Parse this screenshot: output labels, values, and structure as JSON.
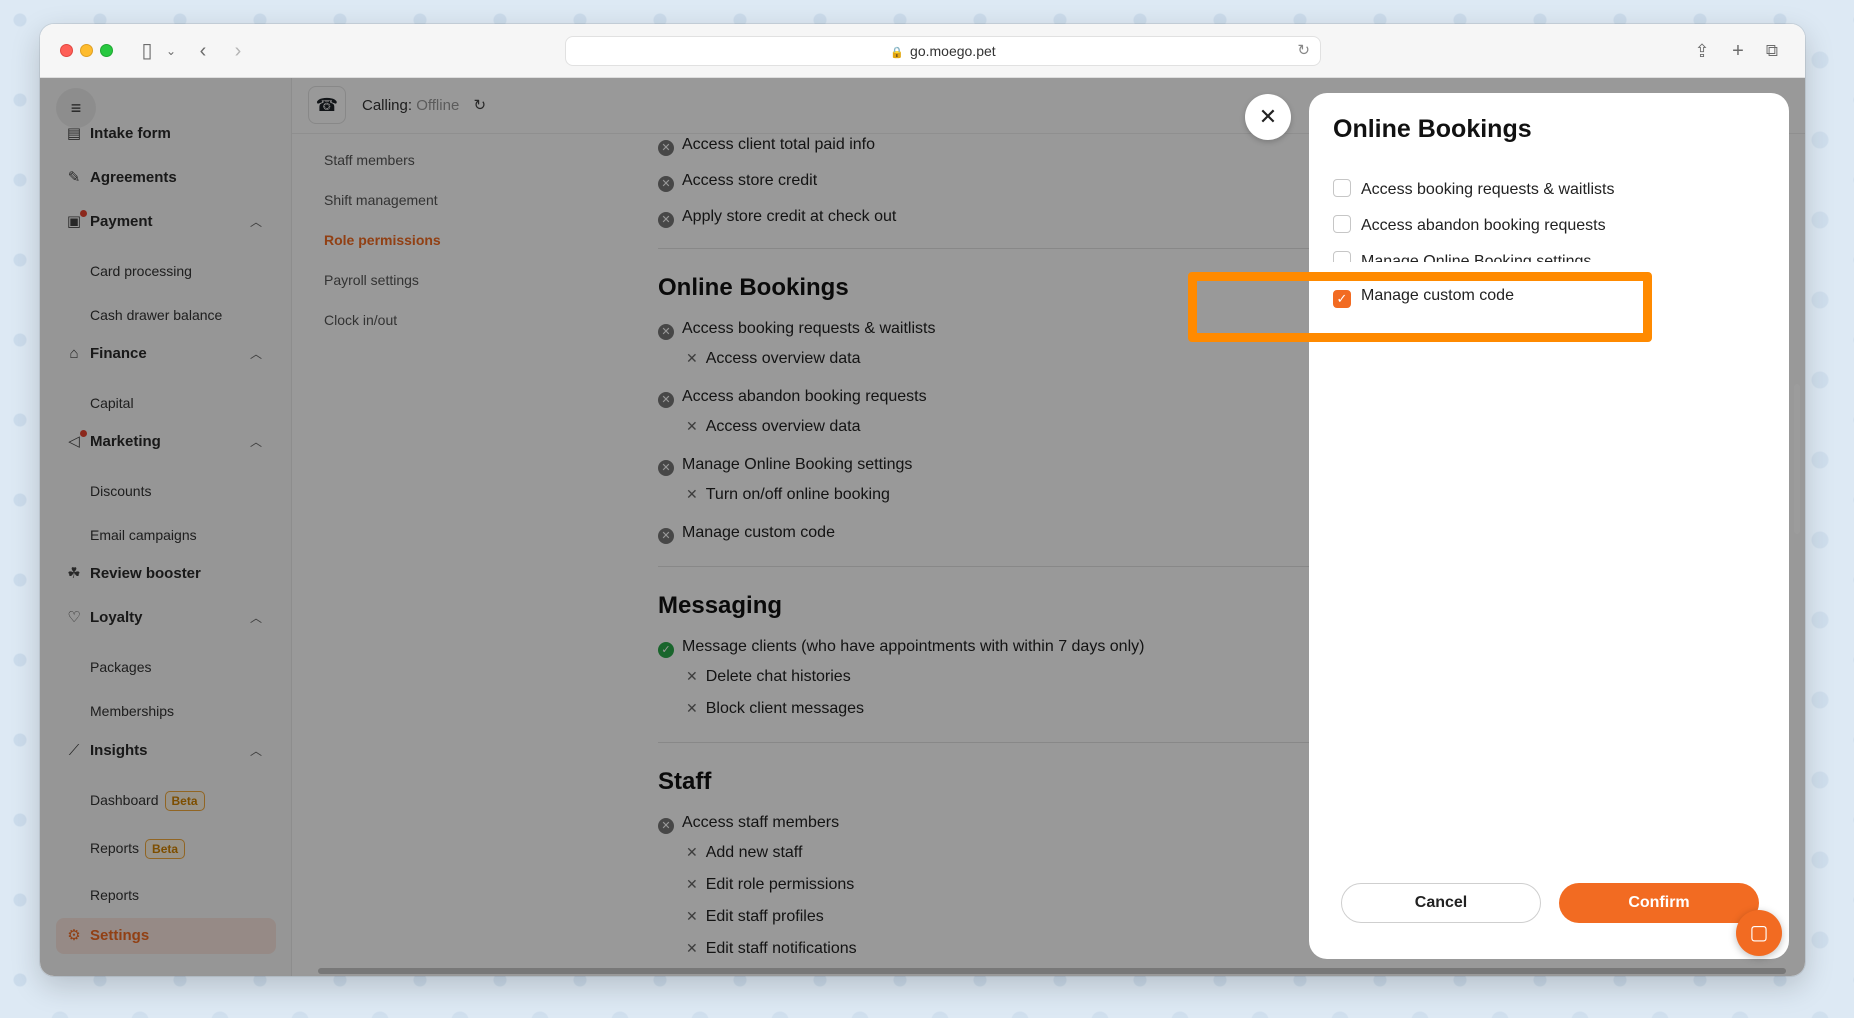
{
  "browser": {
    "url": "go.moego.pet"
  },
  "sidebar": {
    "menu_icon": "hamburger-icon",
    "items": [
      {
        "label": "Intake form",
        "icon": "form-icon"
      },
      {
        "label": "Agreements",
        "icon": "pen-icon"
      },
      {
        "label": "Payment",
        "icon": "payment-icon",
        "expanded": true,
        "dot": true,
        "children": [
          "Card processing",
          "Cash drawer balance"
        ]
      },
      {
        "label": "Finance",
        "icon": "bank-icon",
        "expanded": true,
        "children": [
          "Capital"
        ]
      },
      {
        "label": "Marketing",
        "icon": "megaphone-icon",
        "expanded": true,
        "dot": true,
        "children": [
          "Discounts",
          "Email campaigns"
        ]
      },
      {
        "label": "Review booster",
        "icon": "review-icon"
      },
      {
        "label": "Loyalty",
        "icon": "loyalty-icon",
        "expanded": true,
        "children": [
          "Packages",
          "Memberships"
        ]
      },
      {
        "label": "Insights",
        "icon": "chart-icon",
        "expanded": true
      },
      {
        "label": "Settings",
        "icon": "gear-icon",
        "active": true
      }
    ],
    "insights_children": [
      {
        "label": "Dashboard",
        "badge": "Beta"
      },
      {
        "label": "Reports",
        "badge": "Beta"
      },
      {
        "label": "Reports"
      }
    ]
  },
  "topbar": {
    "calling_label": "Calling:",
    "calling_status": "Offline"
  },
  "subnav": [
    "Staff members",
    "Shift management",
    "Role permissions",
    "Payroll settings",
    "Clock in/out"
  ],
  "content": {
    "payments_tail": [
      "Access client total paid info",
      "Access store credit",
      "Apply store credit at check out"
    ],
    "online_bookings": {
      "title": "Online Bookings",
      "items": [
        {
          "label": "Access booking requests & waitlists",
          "sub": "Access overview data"
        },
        {
          "label": "Access abandon booking requests",
          "sub": "Access overview data"
        },
        {
          "label": "Manage Online Booking settings",
          "sub": "Turn on/off online booking"
        },
        {
          "label": "Manage custom code"
        }
      ]
    },
    "messaging": {
      "title": "Messaging",
      "main": "Message clients (who have appointments with within 7 days only)",
      "subs": [
        "Delete chat histories",
        "Block client messages"
      ]
    },
    "staff": {
      "title": "Staff",
      "main": "Access staff members",
      "subs": [
        "Add new staff",
        "Edit role permissions",
        "Edit staff profiles",
        "Edit staff notifications"
      ]
    }
  },
  "modal": {
    "title": "Online Bookings",
    "options": [
      {
        "label": "Access booking requests & waitlists",
        "checked": false
      },
      {
        "label": "Access abandon booking requests",
        "checked": false
      },
      {
        "label": "Manage Online Booking settings",
        "checked": false
      },
      {
        "label": "Manage custom code",
        "checked": true
      }
    ],
    "cancel_label": "Cancel",
    "confirm_label": "Confirm"
  },
  "colors": {
    "accent": "#f26b22",
    "highlight": "#ff8a00"
  }
}
